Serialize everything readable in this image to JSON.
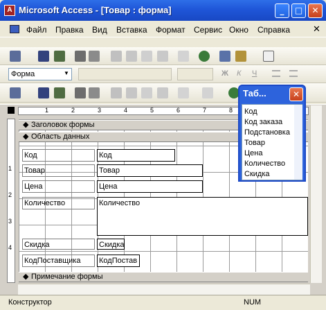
{
  "window": {
    "title": "Microsoft Access - [Товар : форма]",
    "app_icon_letter": "A"
  },
  "menu": {
    "items": [
      "Файл",
      "Правка",
      "Вид",
      "Вставка",
      "Формат",
      "Сервис",
      "Окно",
      "Справка"
    ]
  },
  "format_bar": {
    "object_select": "Форма",
    "bold": "Ж",
    "italic": "К",
    "underline": "Ч"
  },
  "sections": {
    "header": "Заголовок формы",
    "detail": "Область данных",
    "footer": "Примечание формы"
  },
  "controls": {
    "labels": [
      "Код",
      "Товар",
      "Цена",
      "Количество",
      "Скидка",
      "КодПоставщика"
    ],
    "fields": [
      "Код",
      "Товар",
      "Цена",
      "Количество",
      "Скидка",
      "КодПостав"
    ]
  },
  "ruler": {
    "h_ticks": [
      "1",
      "2",
      "3",
      "4",
      "5",
      "6",
      "7",
      "8"
    ],
    "v_ticks": [
      "1",
      "2",
      "3",
      "4"
    ]
  },
  "field_list": {
    "title": "Таб...",
    "items": [
      "Код",
      "Код заказа",
      "Подстановка",
      "Товар",
      "Цена",
      "Количество",
      "Скидка"
    ]
  },
  "status": {
    "mode": "Конструктор",
    "num": "NUM"
  }
}
